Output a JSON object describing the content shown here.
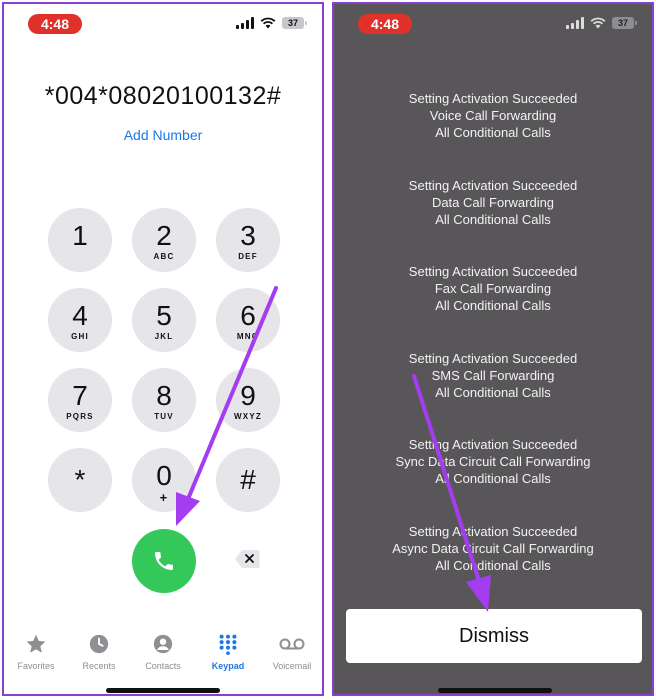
{
  "left": {
    "status": {
      "time": "4:48",
      "battery": "37"
    },
    "dialed_number": "*004*08020100132#",
    "add_number_label": "Add Number",
    "keys": [
      {
        "digit": "1",
        "letters": ""
      },
      {
        "digit": "2",
        "letters": "ABC"
      },
      {
        "digit": "3",
        "letters": "DEF"
      },
      {
        "digit": "4",
        "letters": "GHI"
      },
      {
        "digit": "5",
        "letters": "JKL"
      },
      {
        "digit": "6",
        "letters": "MNO"
      },
      {
        "digit": "7",
        "letters": "PQRS"
      },
      {
        "digit": "8",
        "letters": "TUV"
      },
      {
        "digit": "9",
        "letters": "WXYZ"
      },
      {
        "digit": "*",
        "letters": ""
      },
      {
        "digit": "0",
        "letters": "+"
      },
      {
        "digit": "#",
        "letters": ""
      }
    ],
    "tabs": [
      {
        "label": "Favorites",
        "icon": "star-icon"
      },
      {
        "label": "Recents",
        "icon": "clock-icon"
      },
      {
        "label": "Contacts",
        "icon": "person-icon"
      },
      {
        "label": "Keypad",
        "icon": "keypad-icon",
        "active": true
      },
      {
        "label": "Voicemail",
        "icon": "voicemail-icon"
      }
    ],
    "accent_color": "#1b78e6",
    "call_color": "#34c759"
  },
  "right": {
    "status": {
      "time": "4:48",
      "battery": "37"
    },
    "messages": [
      {
        "status": "Setting Activation Succeeded",
        "service": "Voice Call Forwarding",
        "scope": "All Conditional Calls"
      },
      {
        "status": "Setting Activation Succeeded",
        "service": "Data Call Forwarding",
        "scope": "All Conditional Calls"
      },
      {
        "status": "Setting Activation Succeeded",
        "service": "Fax Call Forwarding",
        "scope": "All Conditional Calls"
      },
      {
        "status": "Setting Activation Succeeded",
        "service": "SMS Call Forwarding",
        "scope": "All Conditional Calls"
      },
      {
        "status": "Setting Activation Succeeded",
        "service": "Sync Data Circuit Call Forwarding",
        "scope": "All Conditional Calls"
      },
      {
        "status": "Setting Activation Succeeded",
        "service": "Async Data Circuit Call Forwarding",
        "scope": "All Conditional Calls"
      }
    ],
    "dismiss_label": "Dismiss"
  },
  "annotation_color": "#a43cf0"
}
